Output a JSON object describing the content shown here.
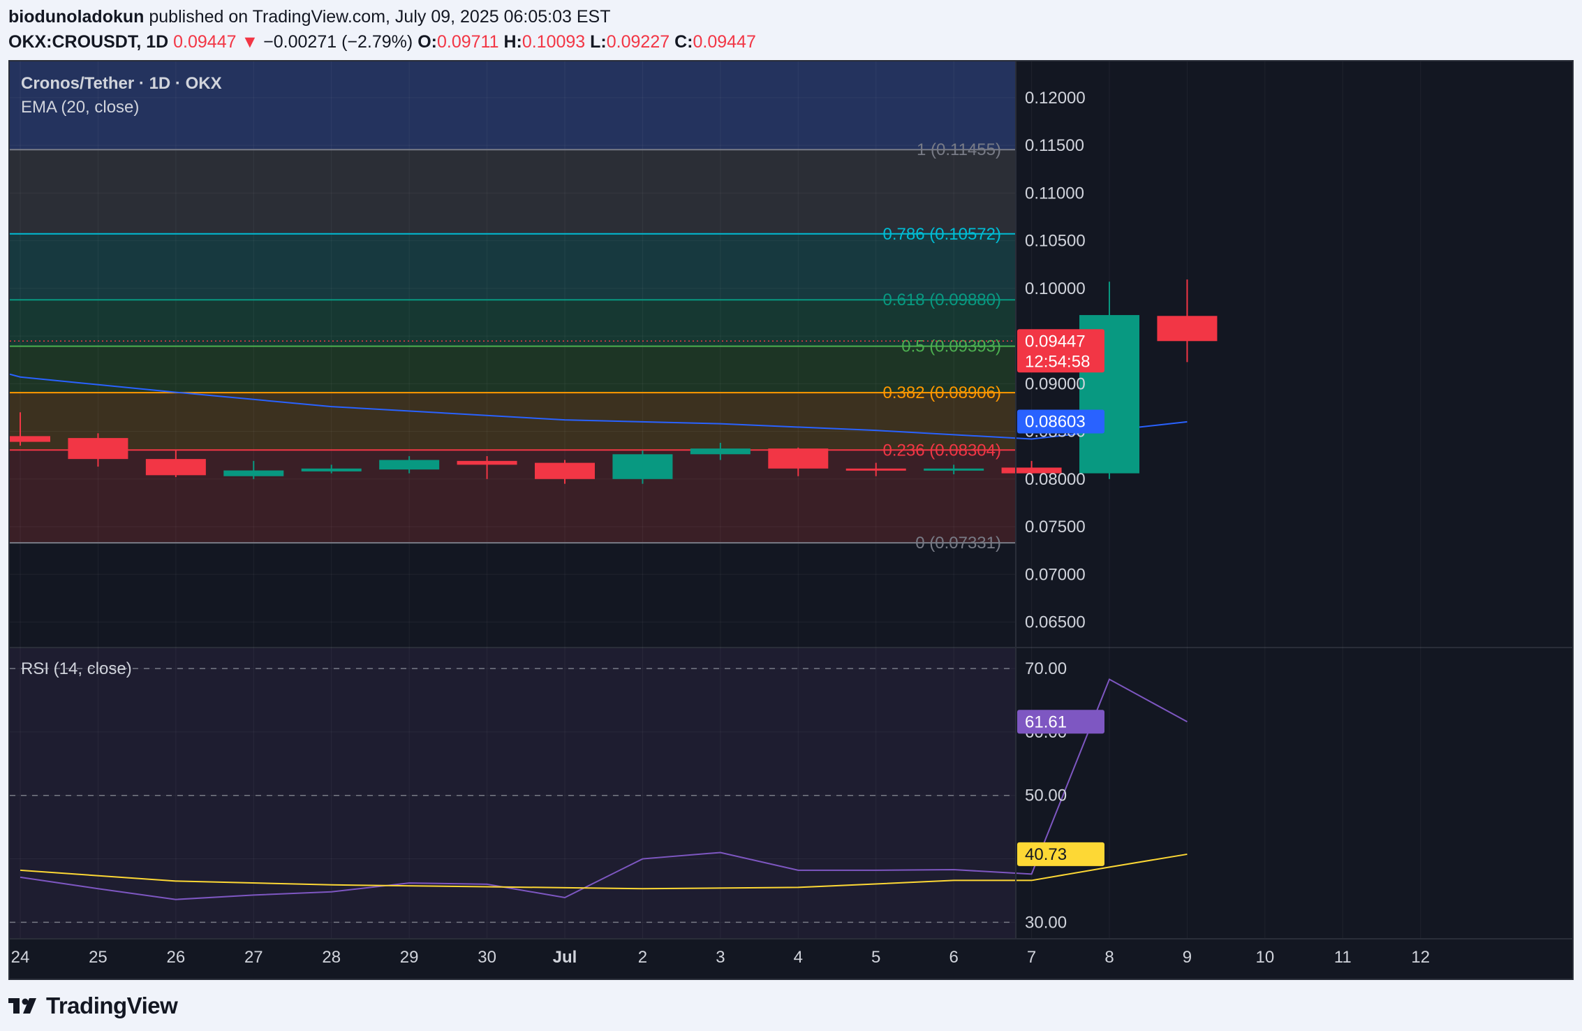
{
  "header": {
    "author": "biodunoladokun",
    "published_text": "published on TradingView.com, July 09, 2025 06:05:03 EST",
    "symbol": "OKX:CROUSDT, 1D",
    "last": "0.09447",
    "arrow": "▼",
    "change": "−0.00271 (−2.79%)",
    "o_label": "O:",
    "o_value": "0.09711",
    "h_label": "H:",
    "h_value": "0.10093",
    "l_label": "L:",
    "l_value": "0.09227",
    "c_label": "C:",
    "c_value": "0.09447"
  },
  "legend": {
    "title": "Cronos/Tether · 1D · OKX",
    "ema": "EMA (20, close)",
    "rsi": "RSI (14, close)"
  },
  "footer": {
    "brand": "TradingView",
    "logo_icon": "tradingview-logo-icon"
  },
  "colors": {
    "background": "#131722",
    "up": "#089981",
    "down": "#f23645",
    "ema": "#2962ff",
    "rsi": "#7e57c2",
    "rsi_ma": "#fdd835"
  },
  "chart_data": [
    {
      "type": "candlestick",
      "title": "Cronos/Tether · 1D · OKX",
      "x_ticks": [
        "24",
        "25",
        "26",
        "27",
        "28",
        "29",
        "30",
        "Jul",
        "2",
        "3",
        "4",
        "5",
        "6",
        "7",
        "8",
        "9",
        "10",
        "11",
        "12"
      ],
      "y_ticks": [
        "0.12000",
        "0.11500",
        "0.11000",
        "0.10500",
        "0.10000",
        "0.09500",
        "0.09000",
        "0.08500",
        "0.08000",
        "0.07500",
        "0.07000",
        "0.06500"
      ],
      "ylim": [
        0.0624,
        0.1238
      ],
      "candles": [
        {
          "x": "24",
          "o": 0.0845,
          "h": 0.087,
          "l": 0.0835,
          "c": 0.0839
        },
        {
          "x": "25",
          "o": 0.0843,
          "h": 0.0848,
          "l": 0.0813,
          "c": 0.0821
        },
        {
          "x": "26",
          "o": 0.0821,
          "h": 0.0831,
          "l": 0.0802,
          "c": 0.0804
        },
        {
          "x": "27",
          "o": 0.0803,
          "h": 0.0819,
          "l": 0.08,
          "c": 0.0809
        },
        {
          "x": "28",
          "o": 0.0808,
          "h": 0.0815,
          "l": 0.0806,
          "c": 0.0811
        },
        {
          "x": "29",
          "o": 0.081,
          "h": 0.0824,
          "l": 0.0806,
          "c": 0.082
        },
        {
          "x": "30",
          "o": 0.0819,
          "h": 0.0824,
          "l": 0.08,
          "c": 0.0815
        },
        {
          "x": "Jul",
          "o": 0.0817,
          "h": 0.082,
          "l": 0.0795,
          "c": 0.08
        },
        {
          "x": "2",
          "o": 0.08,
          "h": 0.083,
          "l": 0.0795,
          "c": 0.0826
        },
        {
          "x": "3",
          "o": 0.0826,
          "h": 0.0838,
          "l": 0.082,
          "c": 0.0832
        },
        {
          "x": "4",
          "o": 0.0832,
          "h": 0.0833,
          "l": 0.0803,
          "c": 0.0811
        },
        {
          "x": "5",
          "o": 0.0811,
          "h": 0.0817,
          "l": 0.0803,
          "c": 0.081
        },
        {
          "x": "6",
          "o": 0.081,
          "h": 0.0815,
          "l": 0.0805,
          "c": 0.0811
        },
        {
          "x": "7",
          "o": 0.0812,
          "h": 0.0819,
          "l": 0.0804,
          "c": 0.0806
        },
        {
          "x": "8",
          "o": 0.0806,
          "h": 0.1007,
          "l": 0.08,
          "c": 0.0972
        },
        {
          "x": "9",
          "o": 0.09711,
          "h": 0.10093,
          "l": 0.09227,
          "c": 0.09447
        }
      ],
      "ema": {
        "name": "EMA (20, close)",
        "points": [
          [
            "24",
            0.0907
          ],
          [
            "26",
            0.0891
          ],
          [
            "28",
            0.0876
          ],
          [
            "Jul",
            0.0862
          ],
          [
            "3",
            0.0858
          ],
          [
            "5",
            0.0851
          ],
          [
            "7",
            0.0842
          ],
          [
            "9",
            0.086
          ]
        ]
      },
      "fib_levels": [
        {
          "label": "1 (0.11455)",
          "value": 0.11455,
          "color": "#787b86"
        },
        {
          "label": "0.786 (0.10572)",
          "value": 0.10572,
          "color": "#00bcd4"
        },
        {
          "label": "0.618 (0.09880)",
          "value": 0.0988,
          "color": "#089981"
        },
        {
          "label": "0.5 (0.09393)",
          "value": 0.09393,
          "color": "#4caf50"
        },
        {
          "label": "0.382 (0.08906)",
          "value": 0.08906,
          "color": "#ff9800"
        },
        {
          "label": "0.236 (0.08304)",
          "value": 0.08304,
          "color": "#f23645"
        },
        {
          "label": "0 (0.07331)",
          "value": 0.07331,
          "color": "#787b86"
        }
      ],
      "price_tags": [
        {
          "value": 0.09447,
          "line1": "0.09447",
          "line2": "12:54:58",
          "color": "#f23645"
        },
        {
          "value": 0.08603,
          "line1": "0.08603",
          "color": "#2962ff"
        }
      ]
    },
    {
      "type": "line",
      "title": "RSI (14, close)",
      "y_ticks": [
        "70.00",
        "60.00",
        "50.00",
        "40.00",
        "30.00"
      ],
      "ylim": [
        27.4,
        73.2
      ],
      "series": [
        {
          "name": "RSI",
          "values": [
            [
              0,
              37.1
            ],
            [
              1,
              35.3
            ],
            [
              2,
              33.6
            ],
            [
              3,
              34.3
            ],
            [
              4,
              34.8
            ],
            [
              5,
              36.2
            ],
            [
              6,
              36.0
            ],
            [
              7,
              33.9
            ],
            [
              8,
              40.0
            ],
            [
              9,
              41.0
            ],
            [
              10,
              38.2
            ],
            [
              11,
              38.2
            ],
            [
              12,
              38.3
            ],
            [
              13,
              37.6
            ],
            [
              14,
              68.3
            ],
            [
              15,
              61.61
            ]
          ]
        },
        {
          "name": "RSI-based MA",
          "values": [
            [
              0,
              38.2
            ],
            [
              2,
              36.5
            ],
            [
              4,
              35.9
            ],
            [
              6,
              35.6
            ],
            [
              8,
              35.3
            ],
            [
              10,
              35.5
            ],
            [
              12,
              36.6
            ],
            [
              13,
              36.6
            ],
            [
              14,
              38.7
            ],
            [
              15,
              40.73
            ]
          ]
        }
      ],
      "bands": [
        70,
        50,
        30
      ],
      "price_tags": [
        {
          "value": 61.61,
          "line1": "61.61",
          "color": "#7e57c2"
        },
        {
          "value": 40.73,
          "line1": "40.73",
          "color": "#fdd835",
          "text_color": "#131722"
        }
      ]
    }
  ]
}
